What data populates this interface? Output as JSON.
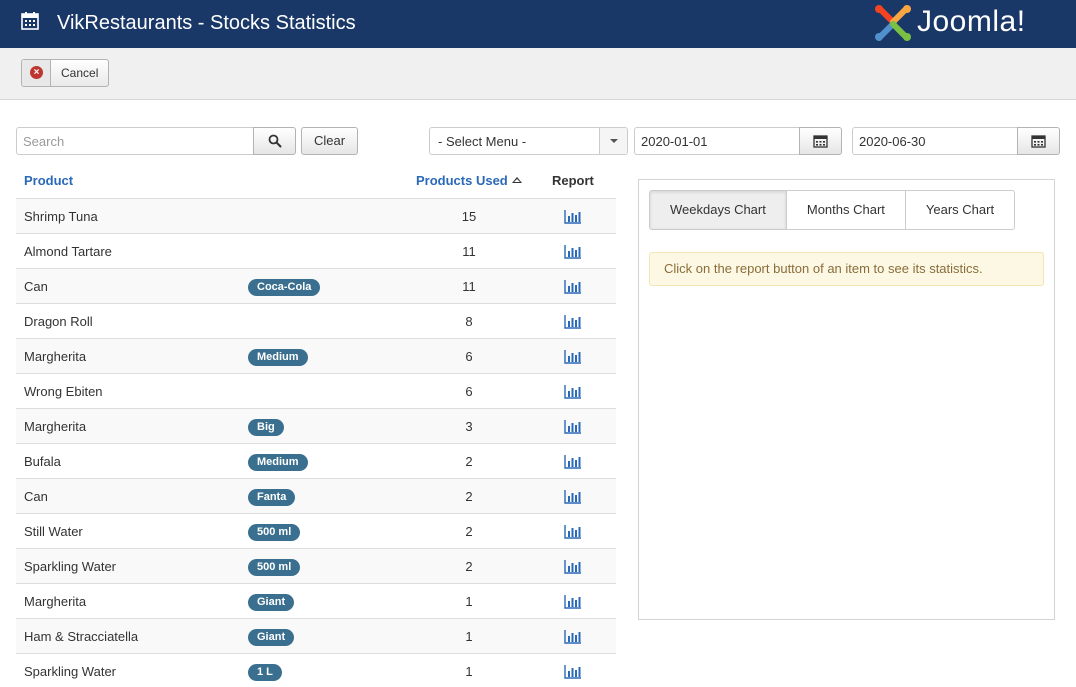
{
  "app": {
    "title": "VikRestaurants - Stocks Statistics",
    "logo_text": "Joomla!",
    "header_color": "#1a3867"
  },
  "toolbar": {
    "cancel_label": "Cancel"
  },
  "filters": {
    "search_placeholder": "Search",
    "clear_label": "Clear",
    "menu_select": "- Select Menu -",
    "date_from": "2020-01-01",
    "date_to": "2020-06-30"
  },
  "table": {
    "headers": {
      "product": "Product",
      "used": "Products Used",
      "report": "Report"
    },
    "rows": [
      {
        "product": "Shrimp Tuna",
        "variation": "",
        "used": "15"
      },
      {
        "product": "Almond Tartare",
        "variation": "",
        "used": "11"
      },
      {
        "product": "Can",
        "variation": "Coca-Cola",
        "used": "11"
      },
      {
        "product": "Dragon Roll",
        "variation": "",
        "used": "8"
      },
      {
        "product": "Margherita",
        "variation": "Medium",
        "used": "6"
      },
      {
        "product": "Wrong Ebiten",
        "variation": "",
        "used": "6"
      },
      {
        "product": "Margherita",
        "variation": "Big",
        "used": "3"
      },
      {
        "product": "Bufala",
        "variation": "Medium",
        "used": "2"
      },
      {
        "product": "Can",
        "variation": "Fanta",
        "used": "2"
      },
      {
        "product": "Still Water",
        "variation": "500 ml",
        "used": "2"
      },
      {
        "product": "Sparkling Water",
        "variation": "500 ml",
        "used": "2"
      },
      {
        "product": "Margherita",
        "variation": "Giant",
        "used": "1"
      },
      {
        "product": "Ham & Stracciatella",
        "variation": "Giant",
        "used": "1"
      },
      {
        "product": "Sparkling Water",
        "variation": "1 L",
        "used": "1"
      }
    ]
  },
  "charts": {
    "tabs": [
      "Weekdays Chart",
      "Months Chart",
      "Years Chart"
    ],
    "active_tab": 0,
    "notice": "Click on the report button of an item to see its statistics."
  }
}
